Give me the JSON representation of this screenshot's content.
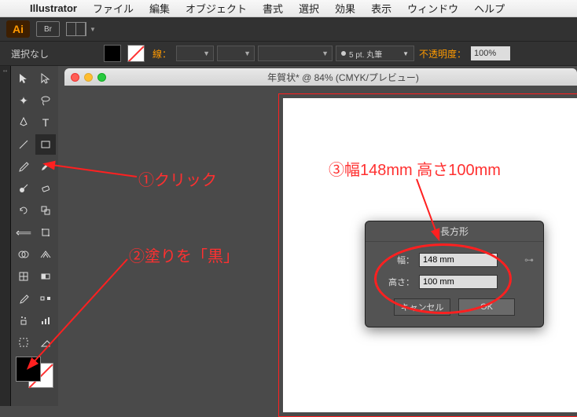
{
  "menubar": {
    "app": "Illustrator",
    "items": [
      "ファイル",
      "編集",
      "オブジェクト",
      "書式",
      "選択",
      "効果",
      "表示",
      "ウィンドウ",
      "ヘルプ"
    ]
  },
  "topbar": {
    "ai": "Ai",
    "br": "Br"
  },
  "control": {
    "selection": "選択なし",
    "stroke_label": "線：",
    "brush": "5 pt. 丸筆",
    "opacity_label": "不透明度：",
    "opacity_value": "100%"
  },
  "document": {
    "title": "年賀状* @ 84% (CMYK/プレビュー)"
  },
  "dialog": {
    "title": "長方形",
    "width_label": "幅：",
    "width_value": "148 mm",
    "height_label": "高さ：",
    "height_value": "100 mm",
    "cancel": "キャンセル",
    "ok": "OK"
  },
  "annotations": {
    "a1": "①クリック",
    "a2": "②塗りを「黒」",
    "a3": "③幅148mm 高さ100mm"
  }
}
